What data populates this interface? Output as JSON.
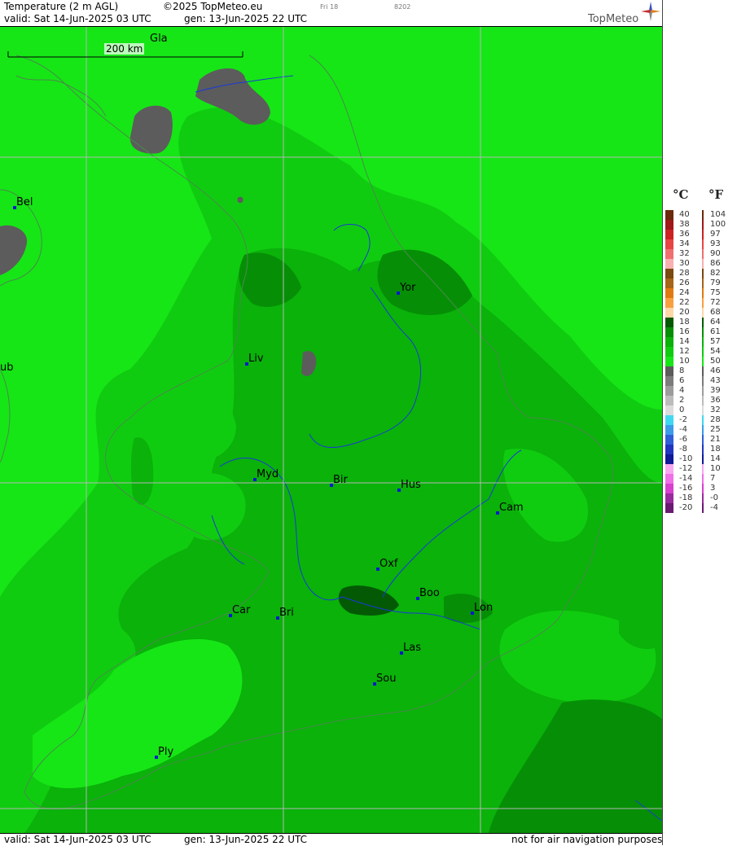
{
  "header": {
    "title": "Temperature (2 m AGL)",
    "copyright": "©2025 TopMeteo.eu",
    "valid": "valid:  Sat  14-Jun-2025  03 UTC",
    "generated": "gen: 13-Jun-2025 22 UTC",
    "tab_small": "Fri 18",
    "code_small": "8202",
    "brand": "TopMeteo"
  },
  "map": {
    "scale_label": "200 km",
    "colors": {
      "c10_12": "#16e616",
      "c12_14": "#10cc10",
      "c14_16": "#0ab20a",
      "c16_18": "#068f06",
      "c8_10": "#5c5c5c",
      "sea_lighter": "#22f022",
      "river": "#1a3ad6",
      "coast": "#4a8a4a",
      "grid": "#b5b5b5"
    },
    "cities": [
      "Gla",
      "Bel",
      "ub",
      "Yor",
      "Liv",
      "Myd",
      "Bir",
      "Hus",
      "Cam",
      "Oxf",
      "Boo",
      "Lon",
      "Car",
      "Bri",
      "Las",
      "Sou",
      "Ply"
    ]
  },
  "footer": {
    "valid": "valid:  Sat  14-Jun-2025  03 UTC",
    "generated": "gen: 13-Jun-2025 22 UTC",
    "disclaimer": "not for air navigation purposes"
  },
  "legend": {
    "celsius_label": "°C",
    "fahrenheit_label": "°F",
    "rows": [
      {
        "c": "40",
        "f": "104",
        "color": "#6b2a0a"
      },
      {
        "c": "38",
        "f": "100",
        "color": "#a01818"
      },
      {
        "c": "36",
        "f": "97",
        "color": "#cc2222"
      },
      {
        "c": "34",
        "f": "93",
        "color": "#e84444"
      },
      {
        "c": "32",
        "f": "90",
        "color": "#f07070"
      },
      {
        "c": "30",
        "f": "86",
        "color": "#f8b0b0"
      },
      {
        "c": "28",
        "f": "82",
        "color": "#7a4a10"
      },
      {
        "c": "26",
        "f": "79",
        "color": "#a86418"
      },
      {
        "c": "24",
        "f": "75",
        "color": "#e07a10"
      },
      {
        "c": "22",
        "f": "72",
        "color": "#f8a040"
      },
      {
        "c": "20",
        "f": "68",
        "color": "#fcd8a8"
      },
      {
        "c": "18",
        "f": "64",
        "color": "#045a04"
      },
      {
        "c": "16",
        "f": "61",
        "color": "#068f06"
      },
      {
        "c": "14",
        "f": "57",
        "color": "#0ab20a"
      },
      {
        "c": "12",
        "f": "54",
        "color": "#10cc10"
      },
      {
        "c": "10",
        "f": "50",
        "color": "#16e616"
      },
      {
        "c": "8",
        "f": "46",
        "color": "#5c5c5c"
      },
      {
        "c": "6",
        "f": "43",
        "color": "#7c7c7c"
      },
      {
        "c": "4",
        "f": "39",
        "color": "#9c9c9c"
      },
      {
        "c": "2",
        "f": "36",
        "color": "#bcbcbc"
      },
      {
        "c": "0",
        "f": "32",
        "color": "#dcdcdc"
      },
      {
        "c": "-2",
        "f": "28",
        "color": "#40d8f0"
      },
      {
        "c": "-4",
        "f": "25",
        "color": "#3c9ce8"
      },
      {
        "c": "-6",
        "f": "21",
        "color": "#3060d8"
      },
      {
        "c": "-8",
        "f": "18",
        "color": "#2036c0"
      },
      {
        "c": "-10",
        "f": "14",
        "color": "#101a98"
      },
      {
        "c": "-12",
        "f": "10",
        "color": "#f8a8f0"
      },
      {
        "c": "-14",
        "f": "7",
        "color": "#f070e8"
      },
      {
        "c": "-16",
        "f": "3",
        "color": "#d840d0"
      },
      {
        "c": "-18",
        "f": "-0",
        "color": "#9a2aa0"
      },
      {
        "c": "-20",
        "f": "-4",
        "color": "#6a1a70"
      }
    ]
  }
}
